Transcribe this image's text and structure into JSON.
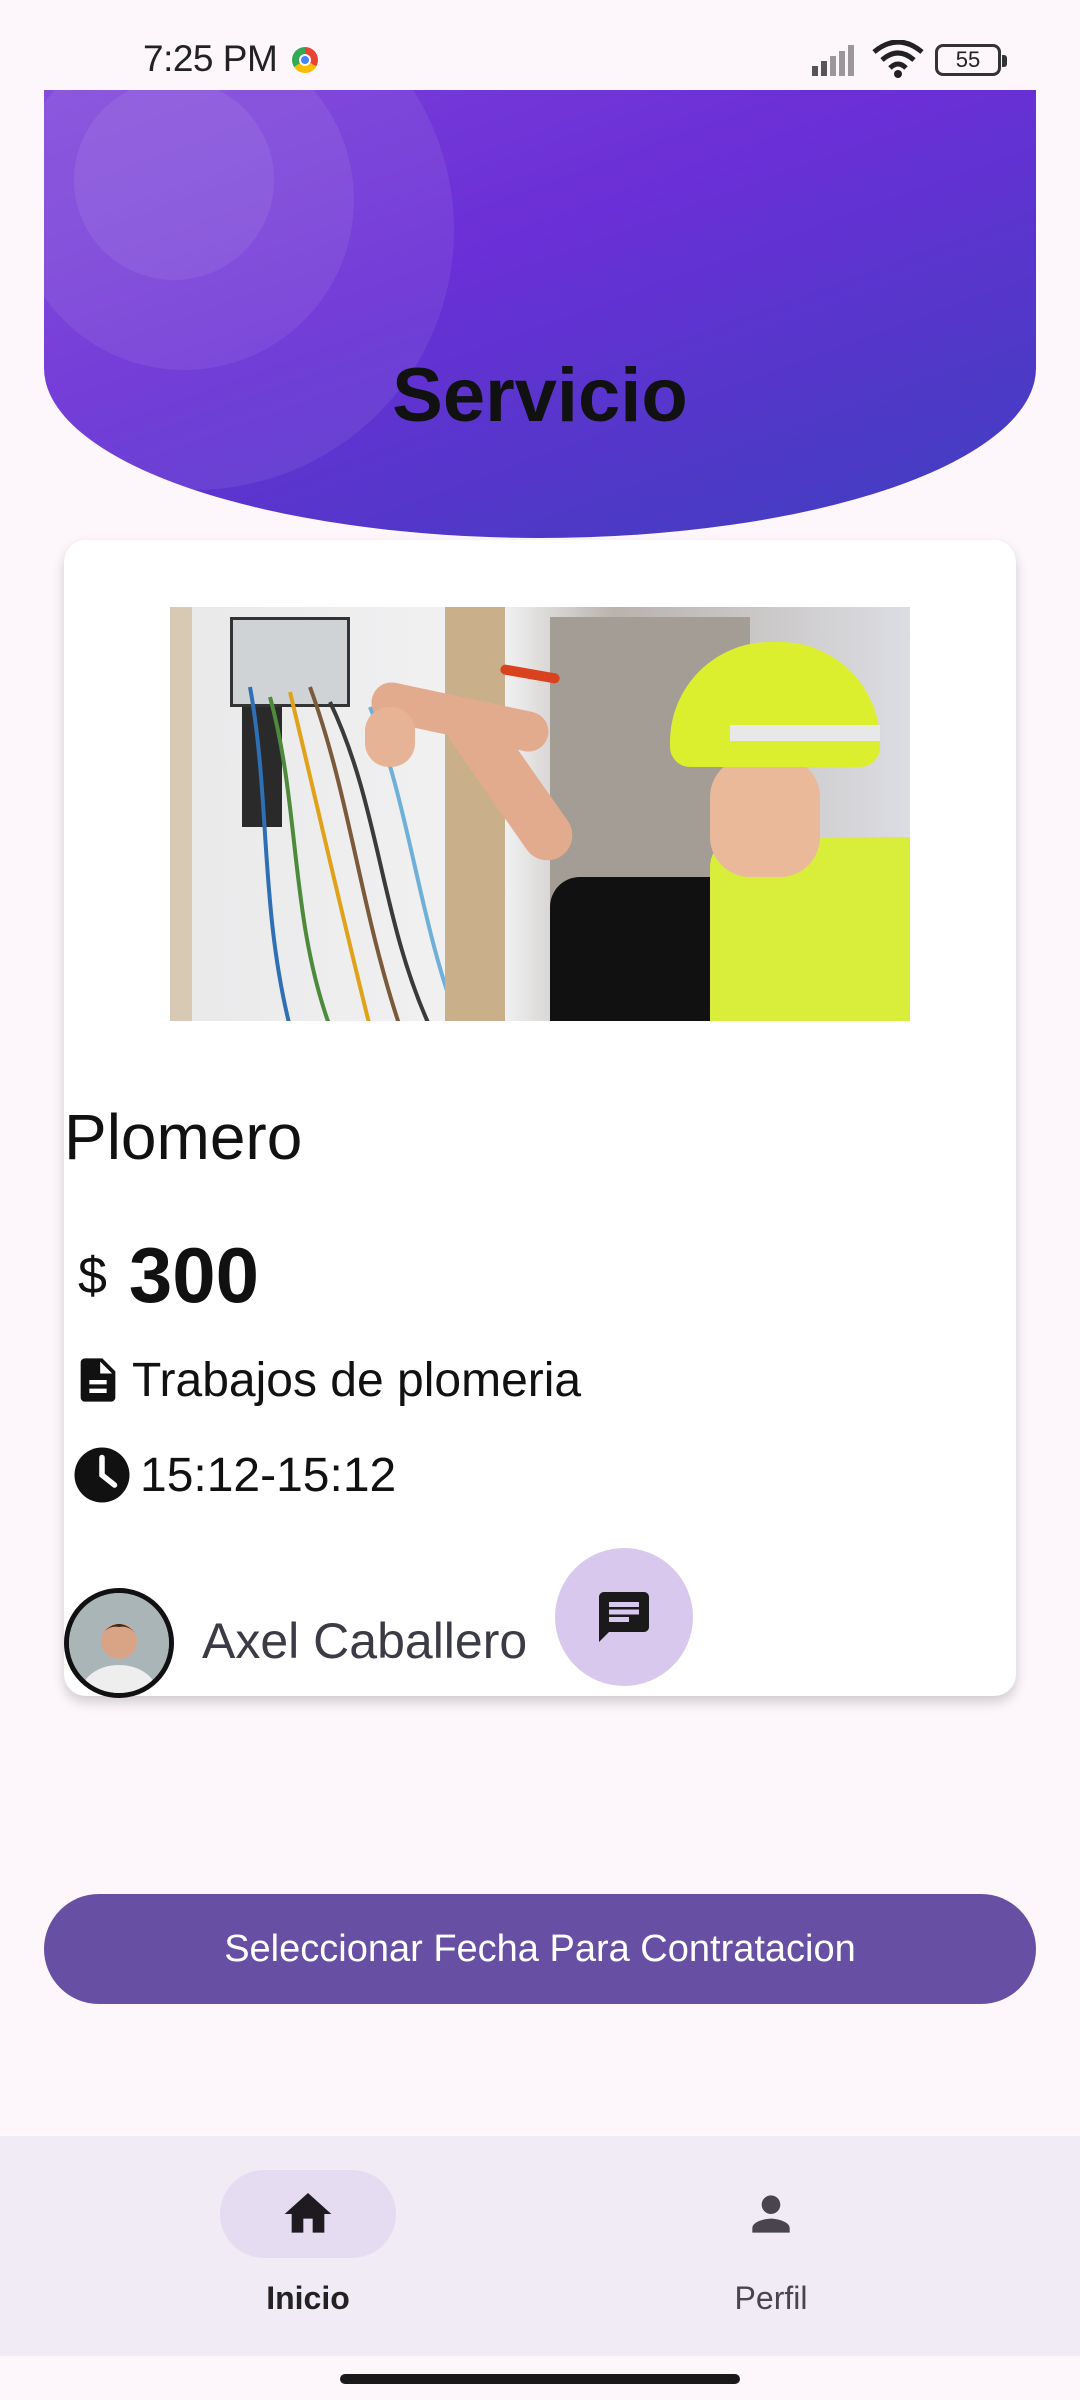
{
  "status_bar": {
    "time": "7:25 PM",
    "battery": "55",
    "icons": [
      "chrome-icon",
      "signal-icon",
      "wifi-icon",
      "battery-icon"
    ]
  },
  "header": {
    "title": "Servicio",
    "colors": {
      "gradient_start": "#7b3fd9",
      "gradient_end": "#3d3fbe"
    }
  },
  "service": {
    "name": "Plomero",
    "currency_symbol": "$",
    "price": "300",
    "description": "Trabajos de plomeria",
    "description_icon": "document-icon",
    "schedule": "15:12-15:12",
    "schedule_icon": "clock-icon",
    "provider": {
      "name": "Axel Caballero",
      "chat_icon": "chat-icon"
    }
  },
  "actions": {
    "select_date_label": "Seleccionar Fecha Para Contratacion",
    "accent": "#6750a4"
  },
  "bottom_nav": {
    "items": [
      {
        "label": "Inicio",
        "icon": "home-icon",
        "active": true
      },
      {
        "label": "Perfil",
        "icon": "person-icon",
        "active": false
      }
    ]
  }
}
